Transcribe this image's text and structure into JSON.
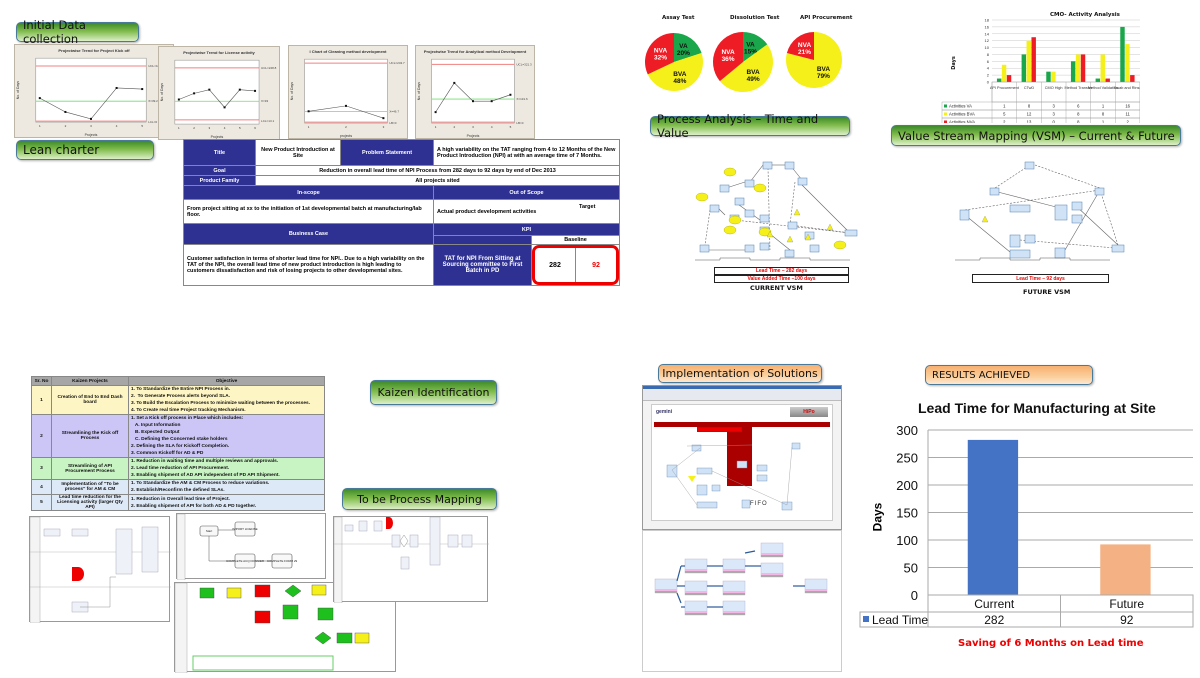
{
  "headers": {
    "initial_data": "Initial Data collection",
    "lean_charter": "Lean charter",
    "process_analysis": "Process Analysis – Time and Value",
    "vsm": "Value Stream Mapping  (VSM) – Current & Future",
    "kaizen": "Kaizen Identification",
    "to_be": "To be Process Mapping",
    "implementation": "Implementation of Solutions",
    "results": "RESULTS ACHIEVED"
  },
  "control_charts": [
    {
      "title": "Projectwise Trend for Project Kick off",
      "xlabel": "Projects",
      "ylabel": "No. of Days",
      "ucl": "UCL=105.3",
      "mean": "X=39.2",
      "lcl": "LCL=0",
      "values": [
        45,
        19,
        6,
        64,
        62
      ],
      "ymax": 120
    },
    {
      "title": "Projectwise Trend for License activity",
      "xlabel": "Projects",
      "ylabel": "No. of Days",
      "ucl": "UCL=228.8",
      "mean": "X=93",
      "lcl": "LCL=13.1",
      "values": [
        100,
        125,
        140,
        68,
        140,
        135
      ],
      "ymax": 260
    },
    {
      "title": "I Chart of Cleaning method development",
      "xlabel": "projects",
      "ylabel": "No. of Days",
      "ucl": "UCL=243.7",
      "mean": "X=46.7",
      "lcl": "LB=0",
      "values": [
        48,
        70,
        20
      ],
      "ymax": 260
    },
    {
      "title": "Projectwise Trend for Analytical method Development",
      "xlabel": "Projects",
      "ylabel": "No. of Days",
      "ucl": "UCL=321.3",
      "mean": "X=131.6",
      "lcl": "LB=0",
      "values": [
        60,
        220,
        120,
        120,
        155
      ],
      "ymax": 350
    }
  ],
  "charter": {
    "title_label": "Title",
    "title_value": "New Product Introduction at Site",
    "problem_label": "Problem Statement",
    "problem_value": "A high variability on the TAT ranging from 4 to 12 Months of the New Product Introduction (NPI) at with an average time of 7 Months.",
    "goal_label": "Goal",
    "goal_value": "Reduction in overall lead time of NPI Process from 282 days to 92 days by end of Dec 2013",
    "family_label": "Product Family",
    "family_value": "All projects sited",
    "inscope_label": "In-scope",
    "outscope_label": "Out of Scope",
    "inscope_value": "From project sitting at xx to the initiation of 1st developmental batch at manufacturing/lab floor.",
    "outscope_value": "Actual product development activities",
    "business_label": "Business Case",
    "kpi_label": "KPI",
    "baseline_label": "Baseline",
    "target_label": "Target",
    "business_value": "Customer satisfaction in terms of shorter lead time for NPI.. Due to a high variability on the TAT of the NPI, the overall lead time of new product introduction is high leading to customers dissatisfaction and risk of losing projects to other developmental sites.",
    "kpi_value": "TAT for NPI From Sitting at Sourcing committee to First Batch in PD",
    "baseline_value": "282",
    "target_value": "92"
  },
  "pies": [
    {
      "title": "Assay Test",
      "slices": [
        {
          "label": "VA",
          "value": 20,
          "color": "#1aa64a"
        },
        {
          "label": "BVA",
          "value": 48,
          "color": "#f5f01a"
        },
        {
          "label": "NVA",
          "value": 32,
          "color": "#ee1c24"
        }
      ]
    },
    {
      "title": "Dissolution Test",
      "slices": [
        {
          "label": "VA",
          "value": 15,
          "color": "#1aa64a"
        },
        {
          "label": "BVA",
          "value": 49,
          "color": "#f5f01a"
        },
        {
          "label": "NVA",
          "value": 36,
          "color": "#ee1c24"
        }
      ]
    },
    {
      "title": "API Procurement",
      "slices": [
        {
          "label": "VA",
          "value": 0,
          "color": "#1aa64a"
        },
        {
          "label": "BVA",
          "value": 79,
          "color": "#f5f01a"
        },
        {
          "label": "NVA",
          "value": 21,
          "color": "#ee1c24"
        }
      ]
    }
  ],
  "cmo_chart": {
    "title": "CMO- Activity Analysis",
    "ylabel": "Days",
    "categories": [
      "API Procurement",
      "CTwD",
      "CMO High",
      "Method Transfer",
      "Method Validation",
      "Swab and Rinse"
    ],
    "series": [
      {
        "name": "Activities VA",
        "color": "#1aa64a",
        "values": [
          1,
          8,
          3,
          6,
          1,
          16
        ]
      },
      {
        "name": "Activities BVA",
        "color": "#f5f01a",
        "values": [
          5,
          12,
          3,
          8,
          8,
          11
        ]
      },
      {
        "name": "Activities NVA",
        "color": "#ee1c24",
        "values": [
          2,
          13,
          0,
          8,
          1,
          2
        ]
      }
    ],
    "yticks": [
      "0",
      "2",
      "4",
      "6",
      "8",
      "10",
      "12",
      "14",
      "16",
      "18"
    ]
  },
  "vsm": {
    "current_lead": "Lead Time – 282 days",
    "current_va": "Value Added Time –100 days",
    "current_label": "CURRENT VSM",
    "future_lead": "Lead Time – 92 days",
    "future_label": "FUTURE VSM"
  },
  "kaizen": {
    "headers": [
      "Sr. No",
      "Kaizen Projects",
      "Objective"
    ],
    "rows": [
      {
        "no": "1",
        "project": "Creation of End to End Dash board",
        "objective": [
          "1. To Standardize the Entire NPI Process in.",
          "2.  To Generate Process alerts beyond SLA.",
          "3. To Build the Escalation Process to minimize waiting between the processes.",
          "4. To Create real time Project tracking Mechanism."
        ]
      },
      {
        "no": "2",
        "project": "Streamlining the Kick off Process",
        "objective": [
          "1. Set a Kick off process in Place which includes:",
          "   A. Input Information",
          "   B. Expected Output",
          "   C. Defining the Concerned stake holders",
          "2. Defining the SLA for Kickoff Completion.",
          "3. Common Kickoff for AD & PD"
        ]
      },
      {
        "no": "3",
        "project": "Streamlining of API Procurement Process",
        "objective": [
          "1. Reduction in waiting time and multiple reviews and approvals.",
          "2. Lead time reduction of API Procurement.",
          "3. Enabling shipment of AD API independent of PD API Shipment."
        ]
      },
      {
        "no": "4",
        "project": "Implementation of \"To be process\" for AM & CM",
        "objective": [
          "1. To Standardize the AM & CM Process to reduce variations.",
          "2. Establish/Reconfirm the defined SLAs."
        ]
      },
      {
        "no": "5",
        "project": "Lead time reduction for the Licensing activity (larger Qty API)",
        "objective": [
          "1. Reduction in Overall lead time of Project.",
          "2. Enabling shipment of API for both AD & PD together."
        ]
      }
    ]
  },
  "to_be_labels": {
    "start": "Start",
    "import": "IMPORT LICENSE",
    "complete1": "COMPLETE ACQ DOSSIER",
    "complete2": "COMPLETE FORM 29",
    "request_material": "Request Material",
    "release": "Release Material",
    "receive": "Receive Material"
  },
  "implementation": {
    "app_logo": "gemini",
    "app_badge": "HiPo",
    "fifo": "FIFO"
  },
  "results_chart": {
    "chart_data": {
      "type": "bar",
      "title": "Lead Time for Manufacturing at Site",
      "categories": [
        "Current",
        "Future"
      ],
      "values": [
        282,
        92
      ],
      "colors": [
        "#4472c4",
        "#f4b183"
      ],
      "series_name": "Lead Time",
      "xlabel": "",
      "ylabel": "Days",
      "ylim": [
        0,
        300
      ],
      "yticks": [
        0,
        50,
        100,
        150,
        200,
        250,
        300
      ],
      "grid": true,
      "legend": "data-table-bottom"
    },
    "footer": "Saving of 6 Months on Lead time"
  }
}
